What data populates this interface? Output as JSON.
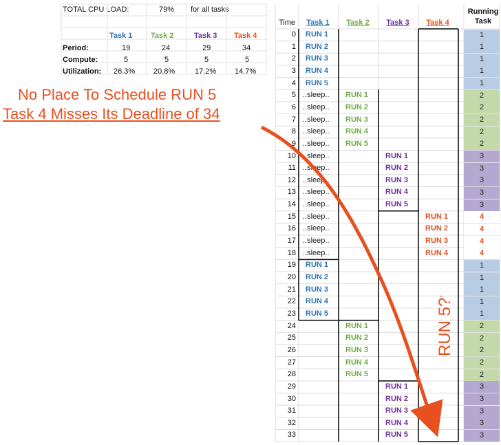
{
  "colors": {
    "task1": "#2e75b6",
    "task2": "#70ad47",
    "task3": "#7030a0",
    "task4": "#e8501f",
    "fill_task1": "#b8cce4",
    "fill_task2": "#c4d9a9",
    "fill_task3": "#b4a7d0",
    "annotation": "#e8501f"
  },
  "summary": {
    "title": "TOTAL CPU LOAD:",
    "load": "79%",
    "load_note": "for all tasks",
    "task_headers": [
      "Task 1",
      "Task 2",
      "Task 3",
      "Task 4"
    ],
    "rows": [
      {
        "label": "Period:",
        "values": [
          "19",
          "24",
          "29",
          "34"
        ]
      },
      {
        "label": "Compute:",
        "values": [
          "5",
          "5",
          "5",
          "5"
        ]
      },
      {
        "label": "Utilization:",
        "values": [
          "26.3%",
          "20.8%",
          "17.2%",
          "14.7%"
        ]
      }
    ]
  },
  "annotation": {
    "line1": "No Place To Schedule RUN 5",
    "line2": "Task 4 Misses Its Deadline of 34",
    "vertical": "RUN 5???"
  },
  "schedule": {
    "headers": {
      "time": "Time",
      "task1": "Task 1",
      "task2": "Task 2",
      "task3": "Task 3",
      "task4": "Task 4",
      "running": "Running Task"
    },
    "rows": [
      {
        "t": "0",
        "t1": "RUN 1",
        "t2": "",
        "t3": "",
        "t4": "",
        "r": "1"
      },
      {
        "t": "1",
        "t1": "RUN 2",
        "t2": "",
        "t3": "",
        "t4": "",
        "r": "1"
      },
      {
        "t": "2",
        "t1": "RUN 3",
        "t2": "",
        "t3": "",
        "t4": "",
        "r": "1"
      },
      {
        "t": "3",
        "t1": "RUN 4",
        "t2": "",
        "t3": "",
        "t4": "",
        "r": "1"
      },
      {
        "t": "4",
        "t1": "RUN 5",
        "t2": "",
        "t3": "",
        "t4": "",
        "r": "1"
      },
      {
        "t": "5",
        "t1": "..sleep..",
        "t2": "RUN 1",
        "t3": "",
        "t4": "",
        "r": "2"
      },
      {
        "t": "6",
        "t1": "..sleep..",
        "t2": "RUN 2",
        "t3": "",
        "t4": "",
        "r": "2"
      },
      {
        "t": "7",
        "t1": "..sleep..",
        "t2": "RUN 3",
        "t3": "",
        "t4": "",
        "r": "2"
      },
      {
        "t": "8",
        "t1": "..sleep..",
        "t2": "RUN 4",
        "t3": "",
        "t4": "",
        "r": "2"
      },
      {
        "t": "9",
        "t1": "..sleep..",
        "t2": "RUN 5",
        "t3": "",
        "t4": "",
        "r": "2"
      },
      {
        "t": "10",
        "t1": "..sleep..",
        "t2": "",
        "t3": "RUN 1",
        "t4": "",
        "r": "3"
      },
      {
        "t": "11",
        "t1": "..sleep..",
        "t2": "",
        "t3": "RUN 2",
        "t4": "",
        "r": "3"
      },
      {
        "t": "12",
        "t1": "..sleep..",
        "t2": "",
        "t3": "RUN 3",
        "t4": "",
        "r": "3"
      },
      {
        "t": "13",
        "t1": "..sleep..",
        "t2": "",
        "t3": "RUN 4",
        "t4": "",
        "r": "3"
      },
      {
        "t": "14",
        "t1": "..sleep..",
        "t2": "",
        "t3": "RUN 5",
        "t4": "",
        "r": "3"
      },
      {
        "t": "15",
        "t1": "..sleep..",
        "t2": "",
        "t3": "",
        "t4": "RUN 1",
        "r": "4"
      },
      {
        "t": "16",
        "t1": "..sleep..",
        "t2": "",
        "t3": "",
        "t4": "RUN 2",
        "r": "4"
      },
      {
        "t": "17",
        "t1": "..sleep..",
        "t2": "",
        "t3": "",
        "t4": "RUN 3",
        "r": "4"
      },
      {
        "t": "18",
        "t1": "..sleep..",
        "t2": "",
        "t3": "",
        "t4": "RUN 4",
        "r": "4"
      },
      {
        "t": "19",
        "t1": "RUN 1",
        "t2": "",
        "t3": "",
        "t4": "",
        "r": "1"
      },
      {
        "t": "20",
        "t1": "RUN 2",
        "t2": "",
        "t3": "",
        "t4": "",
        "r": "1"
      },
      {
        "t": "21",
        "t1": "RUN 3",
        "t2": "",
        "t3": "",
        "t4": "",
        "r": "1"
      },
      {
        "t": "22",
        "t1": "RUN 4",
        "t2": "",
        "t3": "",
        "t4": "",
        "r": "1"
      },
      {
        "t": "23",
        "t1": "RUN 5",
        "t2": "",
        "t3": "",
        "t4": "",
        "r": "1"
      },
      {
        "t": "24",
        "t1": "",
        "t2": "RUN 1",
        "t3": "",
        "t4": "",
        "r": "2"
      },
      {
        "t": "25",
        "t1": "",
        "t2": "RUN 2",
        "t3": "",
        "t4": "",
        "r": "2"
      },
      {
        "t": "26",
        "t1": "",
        "t2": "RUN 3",
        "t3": "",
        "t4": "",
        "r": "2"
      },
      {
        "t": "27",
        "t1": "",
        "t2": "RUN 4",
        "t3": "",
        "t4": "",
        "r": "2"
      },
      {
        "t": "28",
        "t1": "",
        "t2": "RUN 5",
        "t3": "",
        "t4": "",
        "r": "2"
      },
      {
        "t": "29",
        "t1": "",
        "t2": "",
        "t3": "RUN 1",
        "t4": "",
        "r": "3"
      },
      {
        "t": "30",
        "t1": "",
        "t2": "",
        "t3": "RUN 2",
        "t4": "",
        "r": "3"
      },
      {
        "t": "31",
        "t1": "",
        "t2": "",
        "t3": "RUN 3",
        "t4": "",
        "r": "3"
      },
      {
        "t": "32",
        "t1": "",
        "t2": "",
        "t3": "RUN 4",
        "t4": "",
        "r": "3"
      },
      {
        "t": "33",
        "t1": "",
        "t2": "",
        "t3": "RUN 5",
        "t4": "",
        "r": "3"
      }
    ]
  }
}
